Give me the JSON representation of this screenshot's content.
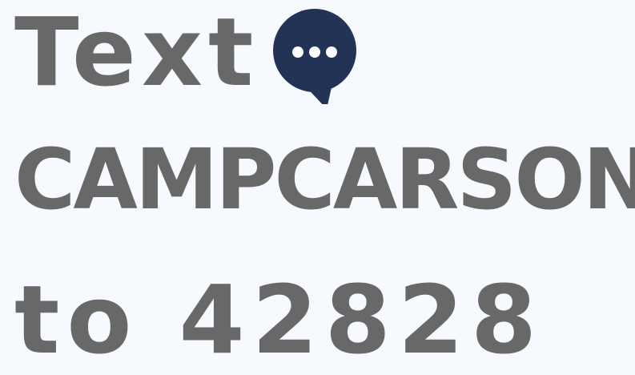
{
  "message": {
    "line1": "Text",
    "line2": "CAMPCARSON",
    "line3": "to 42828"
  },
  "icon": {
    "name": "chat-bubble-icon",
    "fill": "#223356",
    "dot_color": "#ffffff"
  },
  "colors": {
    "text": "#686868",
    "background": "#f6f9fd"
  }
}
